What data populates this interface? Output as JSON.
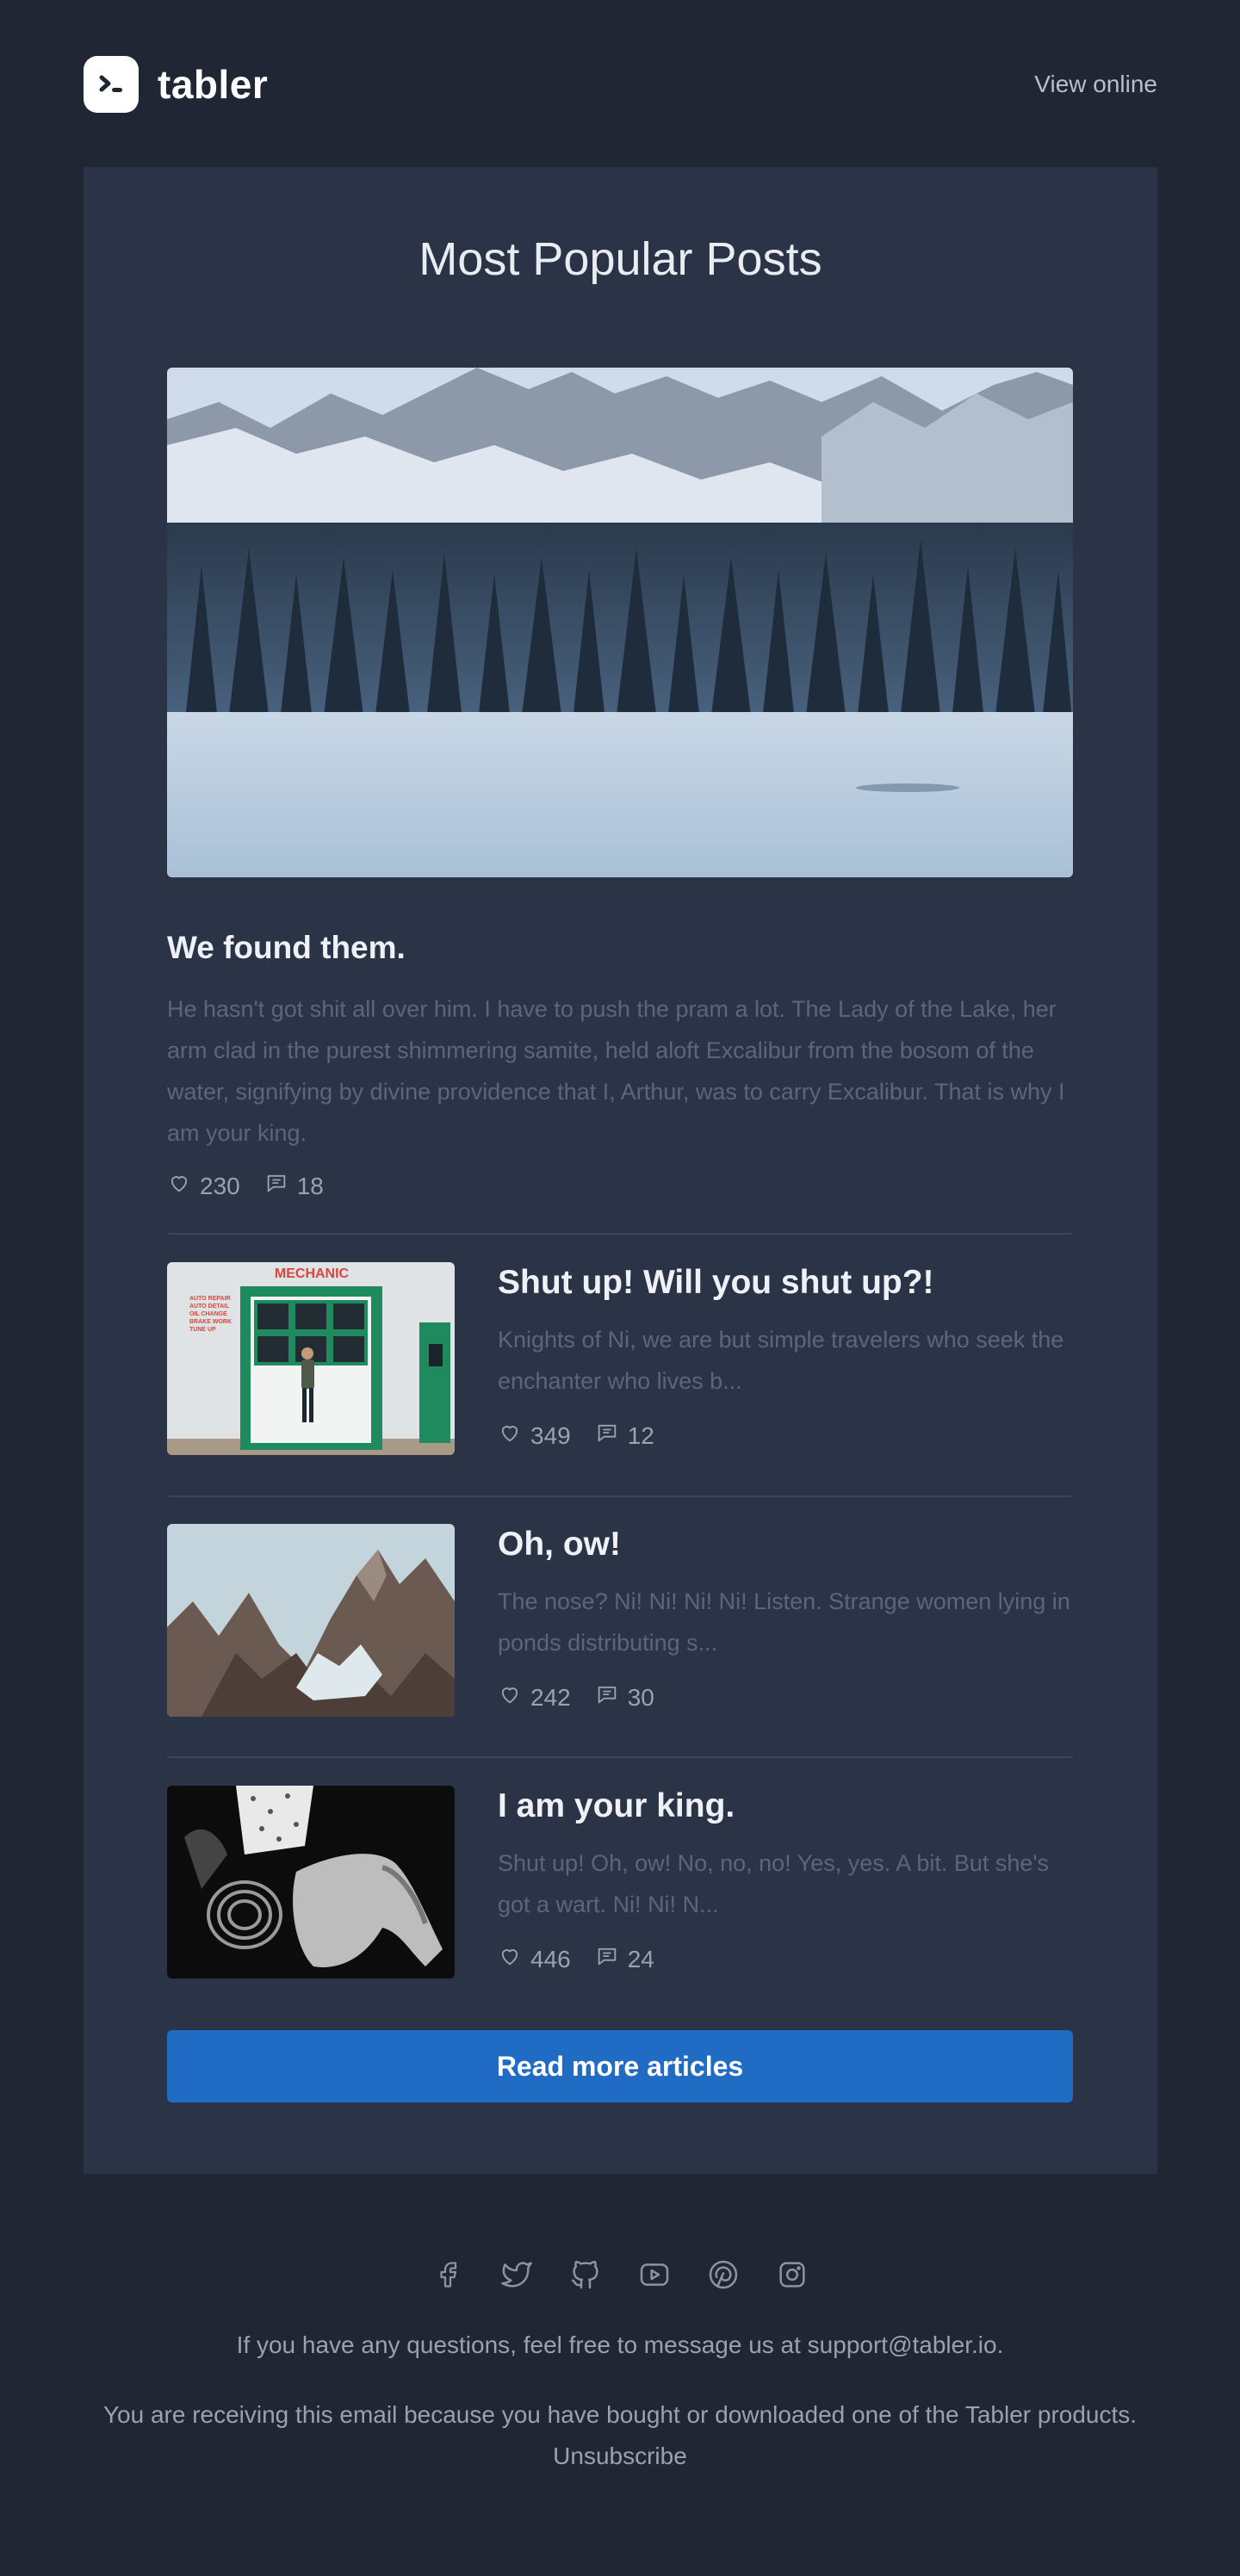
{
  "header": {
    "brand": "tabler",
    "view_online": "View online"
  },
  "card": {
    "title": "Most Popular Posts"
  },
  "hero": {
    "title": "We found them.",
    "text": "He hasn't got shit all over him. I have to push the pram a lot. The Lady of the Lake, her arm clad in the purest shimmering samite, held aloft Excalibur from the bosom of the water, signifying by divine providence that I, Arthur, was to carry Excalibur. That is why I am your king.",
    "likes": "230",
    "comments": "18"
  },
  "posts": [
    {
      "title": "Shut up! Will you shut up?!",
      "text": "Knights of Ni, we are but simple travelers who seek the enchanter who lives b...",
      "likes": "349",
      "comments": "12",
      "sign_text": "MECHANIC",
      "side_text": [
        "AUTO REPAIR",
        "AUTO DETAIL",
        "OIL CHANGE",
        "BRAKE WORK",
        "TUNE UP"
      ]
    },
    {
      "title": "Oh, ow!",
      "text": "The nose? Ni! Ni! Ni! Ni! Listen. Strange women lying in ponds distributing s...",
      "likes": "242",
      "comments": "30"
    },
    {
      "title": "I am your king.",
      "text": "Shut up! Oh, ow! No, no, no! Yes, yes. A bit. But she's got a wart. Ni! Ni! N...",
      "likes": "446",
      "comments": "24"
    }
  ],
  "cta": {
    "label": "Read more articles"
  },
  "footer": {
    "socials": [
      "facebook-icon",
      "twitter-icon",
      "github-icon",
      "youtube-icon",
      "pinterest-icon",
      "instagram-icon"
    ],
    "questions": "If you have any questions, feel free to message us at support@tabler.io.",
    "reason": "You are receiving this email because you have bought or downloaded one of the Tabler products.",
    "unsubscribe": "Unsubscribe"
  },
  "colors": {
    "background": "#212634",
    "card": "#2b3446",
    "accent": "#206bc4",
    "muted_text": "#5d6678",
    "meta_text": "#9aa2ae"
  }
}
